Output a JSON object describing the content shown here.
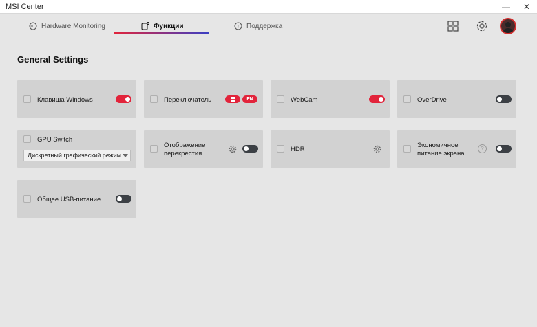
{
  "window": {
    "title": "MSI Center",
    "minimize": "—",
    "close": "✕"
  },
  "tabs": [
    {
      "label": "Hardware Monitoring",
      "icon": "gauge-icon"
    },
    {
      "label": "Функции",
      "icon": "features-icon",
      "active": true
    },
    {
      "label": "Поддержка",
      "icon": "support-chat-icon"
    }
  ],
  "topbar": {
    "icons": [
      "apps-grid-icon",
      "gear-icon",
      "user-avatar"
    ]
  },
  "section": {
    "title": "General Settings"
  },
  "cards": {
    "windows_key": {
      "label": "Клавиша Windows",
      "toggle": "on"
    },
    "switch": {
      "label": "Переключатель",
      "pill_fn": "FN"
    },
    "webcam": {
      "label": "WebCam",
      "toggle": "on"
    },
    "overdrive": {
      "label": "OverDrive",
      "toggle": "off"
    },
    "gpu_switch": {
      "label": "GPU Switch",
      "select_value": "Дискретный графический режим"
    },
    "crosshair": {
      "label_line1": "Отображение",
      "label_line2": "перекрестия",
      "toggle": "off"
    },
    "hdr": {
      "label": "HDR"
    },
    "eco_display": {
      "label_line1": "Экономичное",
      "label_line2": "питание экрана",
      "help": "?",
      "toggle": "off"
    },
    "usb_power": {
      "label": "Общее USB-питание",
      "toggle": "off"
    }
  },
  "colors": {
    "accent": "#e2243b",
    "card_bg": "#d2d2d2",
    "page_bg": "#e6e6e6",
    "toggle_off": "#3c4045"
  }
}
